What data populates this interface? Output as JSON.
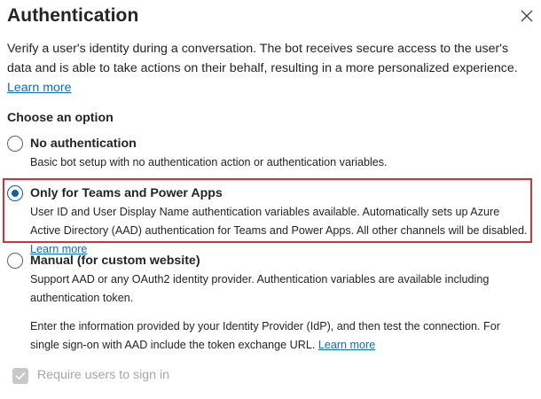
{
  "dialog": {
    "title": "Authentication",
    "close_icon": "close-icon",
    "description": "Verify a user's identity during a conversation. The bot receives secure access to the user's data and is able to take actions on their behalf, resulting in a more personalized experience.",
    "description_link": "Learn more"
  },
  "choose_label": "Choose an option",
  "options": [
    {
      "title": "No authentication",
      "description": "Basic bot setup with no authentication action or authentication variables.",
      "selected": false
    },
    {
      "title": "Only for Teams and Power Apps",
      "description": "User ID and User Display Name authentication variables available. Automatically sets up Azure Active Directory (AAD) authentication for Teams and Power Apps. All other channels will be disabled.",
      "link": "Learn more",
      "selected": true
    },
    {
      "title": "Manual (for custom website)",
      "description": "Support AAD or any OAuth2 identity provider. Authentication variables are available including authentication token.",
      "extra_description": "Enter the information provided by your Identity Provider (IdP), and then test the connection. For single sign-on with AAD include the token exchange URL.",
      "link": "Learn more",
      "selected": false
    }
  ],
  "require_signin": {
    "label": "Require users to sign in",
    "checked": true,
    "disabled": true
  },
  "colors": {
    "accent": "#115ea3",
    "link": "#0f6cbd",
    "highlight_border": "#d13438",
    "disabled_text": "#a6a6a6"
  }
}
